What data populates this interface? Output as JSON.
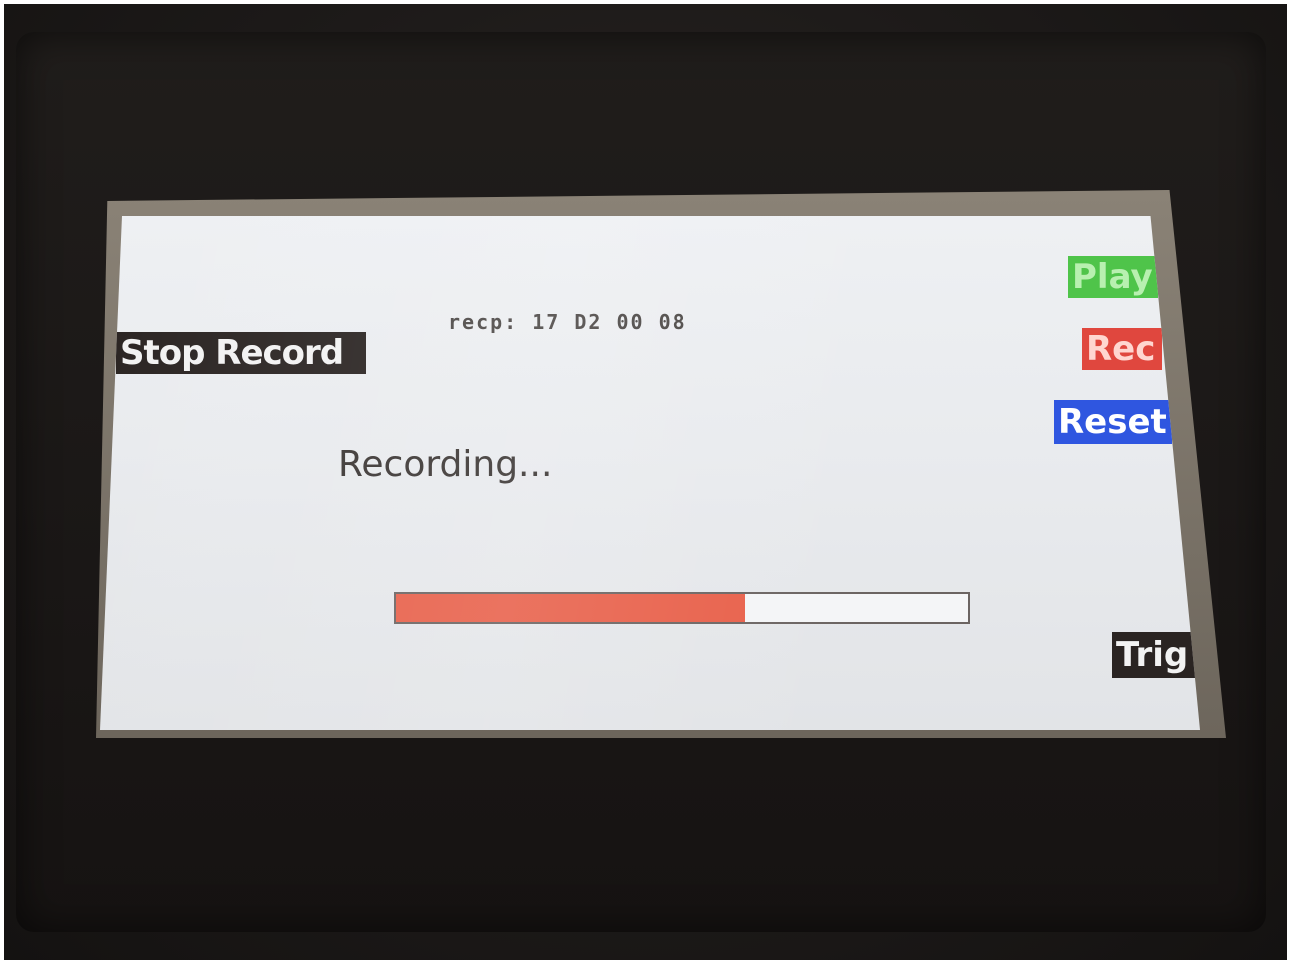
{
  "screen": {
    "recp_text": "recp: 17 D2 00 08",
    "status_text": "Recording...",
    "progress": 0.61
  },
  "buttons": {
    "stop_record": "Stop Record",
    "play": "Play",
    "rec": "Rec",
    "reset": "Reset",
    "trig": "Trig"
  },
  "colors": {
    "play": "#4fc44a",
    "rec": "#e0473e",
    "reset": "#2f56e0",
    "trig": "#2a2422",
    "stop_record": "#2a2422",
    "progress_fill": "#e8604a",
    "screen_bg": "#eceef1"
  }
}
